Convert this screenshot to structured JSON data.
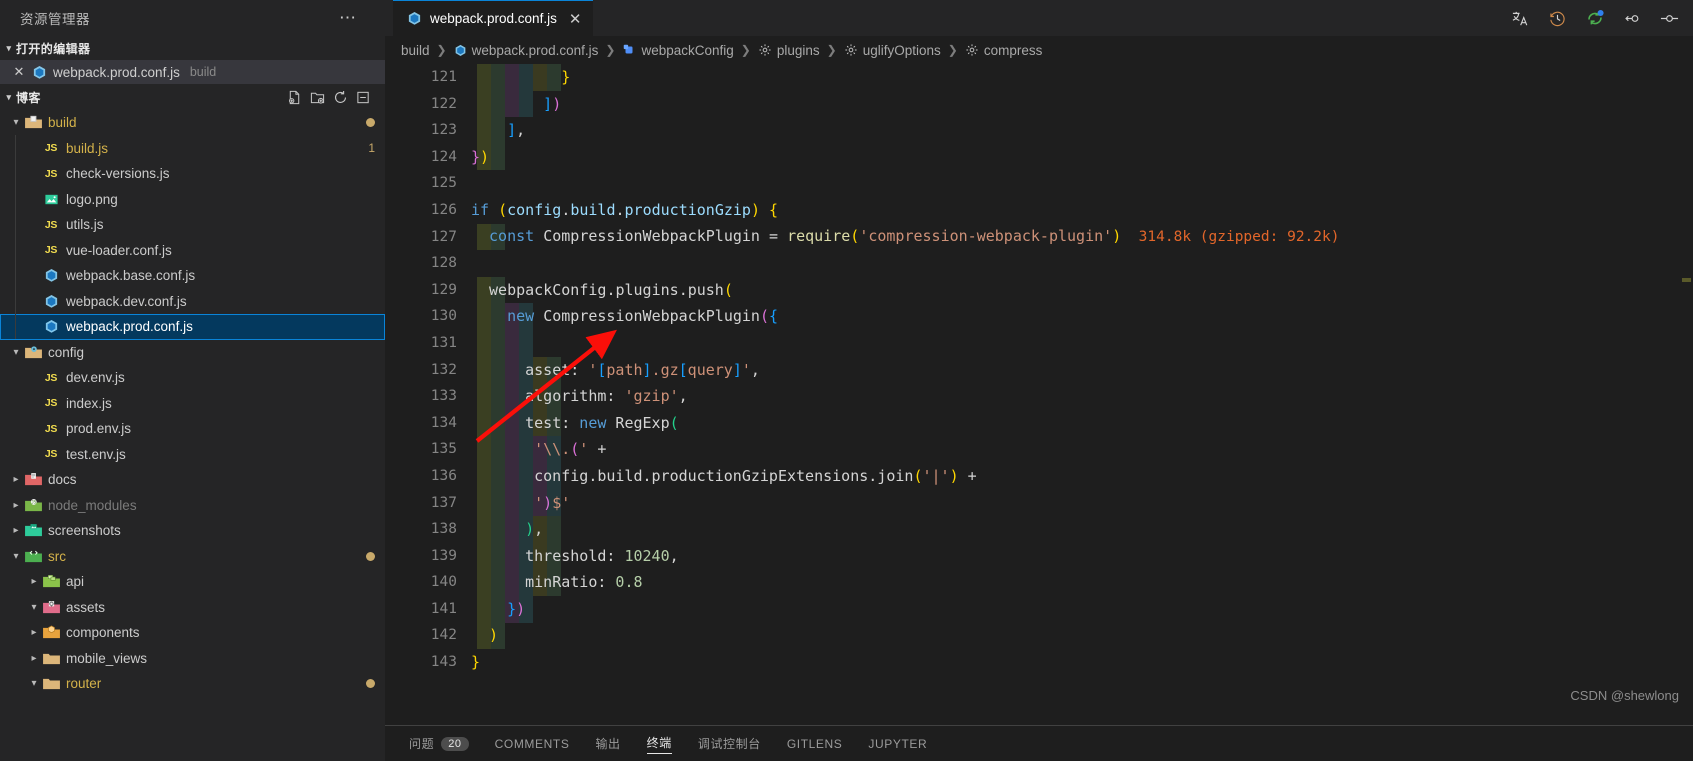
{
  "sidebar": {
    "title": "资源管理器",
    "more_label": "⋯",
    "open_editors": {
      "header": "打开的编辑器",
      "items": [
        {
          "close": "✕",
          "name": "webpack.prod.conf.js",
          "folder": "build",
          "icon": "webpack-icon"
        }
      ]
    },
    "project": {
      "header": "博客",
      "actions": [
        "new-file-icon",
        "new-folder-icon",
        "refresh-icon",
        "collapse-all-icon"
      ]
    },
    "tree": [
      {
        "label": "build",
        "type": "folder",
        "icon": "folder-build-icon",
        "depth": 0,
        "expanded": true,
        "state": "modified",
        "gitdot": true
      },
      {
        "label": "build.js",
        "type": "file",
        "icon": "js-icon",
        "depth": 1,
        "state": "modified",
        "badge": "1"
      },
      {
        "label": "check-versions.js",
        "type": "file",
        "icon": "js-icon",
        "depth": 1
      },
      {
        "label": "logo.png",
        "type": "file",
        "icon": "image-icon",
        "depth": 1
      },
      {
        "label": "utils.js",
        "type": "file",
        "icon": "js-icon",
        "depth": 1
      },
      {
        "label": "vue-loader.conf.js",
        "type": "file",
        "icon": "js-icon",
        "depth": 1
      },
      {
        "label": "webpack.base.conf.js",
        "type": "file",
        "icon": "webpack-icon",
        "depth": 1
      },
      {
        "label": "webpack.dev.conf.js",
        "type": "file",
        "icon": "webpack-icon",
        "depth": 1
      },
      {
        "label": "webpack.prod.conf.js",
        "type": "file",
        "icon": "webpack-icon",
        "depth": 1,
        "selected": true
      },
      {
        "label": "config",
        "type": "folder",
        "icon": "folder-config-icon",
        "depth": 0,
        "expanded": true
      },
      {
        "label": "dev.env.js",
        "type": "file",
        "icon": "js-icon",
        "depth": 1
      },
      {
        "label": "index.js",
        "type": "file",
        "icon": "js-icon",
        "depth": 1
      },
      {
        "label": "prod.env.js",
        "type": "file",
        "icon": "js-icon",
        "depth": 1
      },
      {
        "label": "test.env.js",
        "type": "file",
        "icon": "js-icon",
        "depth": 1
      },
      {
        "label": "docs",
        "type": "folder",
        "icon": "folder-docs-icon",
        "depth": 0,
        "expanded": false
      },
      {
        "label": "node_modules",
        "type": "folder",
        "icon": "folder-node-icon",
        "depth": 0,
        "expanded": false,
        "state": "ignored"
      },
      {
        "label": "screenshots",
        "type": "folder",
        "icon": "folder-images-icon",
        "depth": 0,
        "expanded": false
      },
      {
        "label": "src",
        "type": "folder",
        "icon": "folder-src-icon",
        "depth": 0,
        "expanded": true,
        "state": "modified",
        "gitdot": true
      },
      {
        "label": "api",
        "type": "folder",
        "icon": "folder-api-icon",
        "depth": 1,
        "expanded": false
      },
      {
        "label": "assets",
        "type": "folder",
        "icon": "folder-assets-icon",
        "depth": 1,
        "expanded": true
      },
      {
        "label": "components",
        "type": "folder",
        "icon": "folder-components-icon",
        "depth": 1,
        "expanded": false
      },
      {
        "label": "mobile_views",
        "type": "folder",
        "icon": "folder-icon",
        "depth": 1,
        "expanded": false
      },
      {
        "label": "router",
        "type": "folder",
        "icon": "folder-router-icon",
        "depth": 1,
        "expanded": true,
        "state": "modified",
        "gitdot": true
      }
    ]
  },
  "tabs": [
    {
      "label": "webpack.prod.conf.js",
      "icon": "webpack-icon",
      "close": "✕",
      "active": true
    }
  ],
  "titlebar_actions": [
    "translate-icon",
    "history-icon",
    "sync-icon",
    "split-editor-icon",
    "toggle-icon"
  ],
  "breadcrumb": [
    {
      "label": "build",
      "icon": null
    },
    {
      "label": "webpack.prod.conf.js",
      "icon": "webpack-icon"
    },
    {
      "label": "webpackConfig",
      "icon": "variable-icon"
    },
    {
      "label": "plugins",
      "icon": "property-icon"
    },
    {
      "label": "uglifyOptions",
      "icon": "property-icon"
    },
    {
      "label": "compress",
      "icon": "property-icon"
    }
  ],
  "editor": {
    "first_line": 121,
    "import_cost": "314.8k (gzipped: 92.2k)",
    "lines": [
      {
        "n": 121,
        "indent": 10,
        "tokens": [
          {
            "t": "}",
            "c": "k-par-y"
          }
        ]
      },
      {
        "n": 122,
        "indent": 8,
        "tokens": [
          {
            "t": "]",
            "c": "k-par-b"
          },
          {
            "t": ")",
            "c": "k-par-p"
          }
        ]
      },
      {
        "n": 123,
        "indent": 4,
        "tokens": [
          {
            "t": "]",
            "c": "k-par-b"
          },
          {
            "t": ",",
            "c": "k-plain"
          }
        ]
      },
      {
        "n": 124,
        "indent": 0,
        "tokens": [
          {
            "t": "}",
            "c": "k-par-p"
          },
          {
            "t": ")",
            "c": "k-par-y"
          }
        ]
      },
      {
        "n": 125,
        "indent": 0,
        "tokens": []
      },
      {
        "n": 126,
        "indent": 0,
        "tokens": [
          {
            "t": "if ",
            "c": "k-ctrl"
          },
          {
            "t": "(",
            "c": "k-par-y"
          },
          {
            "t": "config",
            "c": "k-var"
          },
          {
            "t": ".",
            "c": "k-plain"
          },
          {
            "t": "build",
            "c": "k-var"
          },
          {
            "t": ".",
            "c": "k-plain"
          },
          {
            "t": "productionGzip",
            "c": "k-var"
          },
          {
            "t": ")",
            "c": "k-par-y"
          },
          {
            "t": " {",
            "c": "k-par-y"
          }
        ]
      },
      {
        "n": 127,
        "indent": 2,
        "tokens": [
          {
            "t": "const ",
            "c": "k-ctrl"
          },
          {
            "t": "CompressionWebpackPlugin",
            "c": "k-plain"
          },
          {
            "t": " = ",
            "c": "k-plain"
          },
          {
            "t": "require",
            "c": "k-fn"
          },
          {
            "t": "(",
            "c": "k-par-y"
          },
          {
            "t": "'compression-webpack-plugin'",
            "c": "k-str"
          },
          {
            "t": ")",
            "c": "k-par-y"
          }
        ],
        "annotation": "314.8k (gzipped: 92.2k)"
      },
      {
        "n": 128,
        "indent": 0,
        "tokens": []
      },
      {
        "n": 129,
        "indent": 2,
        "tokens": [
          {
            "t": "webpackConfig",
            "c": "k-plain"
          },
          {
            "t": ".",
            "c": "k-plain"
          },
          {
            "t": "plugins",
            "c": "k-plain"
          },
          {
            "t": ".",
            "c": "k-plain"
          },
          {
            "t": "push",
            "c": "k-plain"
          },
          {
            "t": "(",
            "c": "k-par-y"
          }
        ]
      },
      {
        "n": 130,
        "indent": 4,
        "tokens": [
          {
            "t": "new ",
            "c": "k-ctrl"
          },
          {
            "t": "CompressionWebpackPlugin",
            "c": "k-plain"
          },
          {
            "t": "(",
            "c": "k-par-p"
          },
          {
            "t": "{",
            "c": "k-par-b"
          }
        ]
      },
      {
        "n": 131,
        "indent": 0,
        "tokens": []
      },
      {
        "n": 132,
        "indent": 6,
        "tokens": [
          {
            "t": "asset",
            "c": "k-plain"
          },
          {
            "t": ": ",
            "c": "k-plain"
          },
          {
            "t": "'",
            "c": "k-str"
          },
          {
            "t": "[",
            "c": "k-par-b"
          },
          {
            "t": "path",
            "c": "k-str"
          },
          {
            "t": "]",
            "c": "k-par-b"
          },
          {
            "t": ".gz",
            "c": "k-str"
          },
          {
            "t": "[",
            "c": "k-par-b"
          },
          {
            "t": "query",
            "c": "k-str"
          },
          {
            "t": "]",
            "c": "k-par-b"
          },
          {
            "t": "'",
            "c": "k-str"
          },
          {
            "t": ",",
            "c": "k-plain"
          }
        ]
      },
      {
        "n": 133,
        "indent": 6,
        "tokens": [
          {
            "t": "algorithm",
            "c": "k-plain"
          },
          {
            "t": ": ",
            "c": "k-plain"
          },
          {
            "t": "'gzip'",
            "c": "k-str"
          },
          {
            "t": ",",
            "c": "k-plain"
          }
        ]
      },
      {
        "n": 134,
        "indent": 6,
        "tokens": [
          {
            "t": "test",
            "c": "k-plain"
          },
          {
            "t": ": ",
            "c": "k-plain"
          },
          {
            "t": "new ",
            "c": "k-ctrl"
          },
          {
            "t": "RegExp",
            "c": "k-plain"
          },
          {
            "t": "(",
            "c": "k-par-g"
          }
        ]
      },
      {
        "n": 135,
        "indent": 7,
        "tokens": [
          {
            "t": "'\\\\.",
            "c": "k-str"
          },
          {
            "t": "(",
            "c": "k-par-p"
          },
          {
            "t": "'",
            "c": "k-str"
          },
          {
            "t": " +",
            "c": "k-plain"
          }
        ]
      },
      {
        "n": 136,
        "indent": 7,
        "tokens": [
          {
            "t": "config",
            "c": "k-plain"
          },
          {
            "t": ".",
            "c": "k-plain"
          },
          {
            "t": "build",
            "c": "k-plain"
          },
          {
            "t": ".",
            "c": "k-plain"
          },
          {
            "t": "productionGzipExtensions",
            "c": "k-plain"
          },
          {
            "t": ".",
            "c": "k-plain"
          },
          {
            "t": "join",
            "c": "k-plain"
          },
          {
            "t": "(",
            "c": "k-par-y"
          },
          {
            "t": "'|'",
            "c": "k-str"
          },
          {
            "t": ")",
            "c": "k-par-y"
          },
          {
            "t": " +",
            "c": "k-plain"
          }
        ]
      },
      {
        "n": 137,
        "indent": 7,
        "tokens": [
          {
            "t": "'",
            "c": "k-str"
          },
          {
            "t": ")",
            "c": "k-par-p"
          },
          {
            "t": "$'",
            "c": "k-str"
          }
        ]
      },
      {
        "n": 138,
        "indent": 6,
        "tokens": [
          {
            "t": ")",
            "c": "k-par-g"
          },
          {
            "t": ",",
            "c": "k-plain"
          }
        ]
      },
      {
        "n": 139,
        "indent": 6,
        "tokens": [
          {
            "t": "threshold",
            "c": "k-plain"
          },
          {
            "t": ": ",
            "c": "k-plain"
          },
          {
            "t": "10240",
            "c": "k-num"
          },
          {
            "t": ",",
            "c": "k-plain"
          }
        ]
      },
      {
        "n": 140,
        "indent": 6,
        "tokens": [
          {
            "t": "minRatio",
            "c": "k-plain"
          },
          {
            "t": ": ",
            "c": "k-plain"
          },
          {
            "t": "0.8",
            "c": "k-num"
          }
        ]
      },
      {
        "n": 141,
        "indent": 4,
        "tokens": [
          {
            "t": "}",
            "c": "k-par-b"
          },
          {
            "t": ")",
            "c": "k-par-p"
          }
        ]
      },
      {
        "n": 142,
        "indent": 2,
        "tokens": [
          {
            "t": ")",
            "c": "k-par-y"
          }
        ]
      },
      {
        "n": 143,
        "indent": 0,
        "tokens": [
          {
            "t": "}",
            "c": "k-par-y"
          }
        ]
      }
    ]
  },
  "panel": {
    "tabs": [
      {
        "label": "问题",
        "count": "20",
        "active": false
      },
      {
        "label": "COMMENTS",
        "active": false
      },
      {
        "label": "输出",
        "active": false
      },
      {
        "label": "终端",
        "active": true
      },
      {
        "label": "调试控制台",
        "active": false
      },
      {
        "label": "GITLENS",
        "active": false
      },
      {
        "label": "JUPYTER",
        "active": false
      }
    ]
  },
  "watermark": "CSDN @shewlong"
}
